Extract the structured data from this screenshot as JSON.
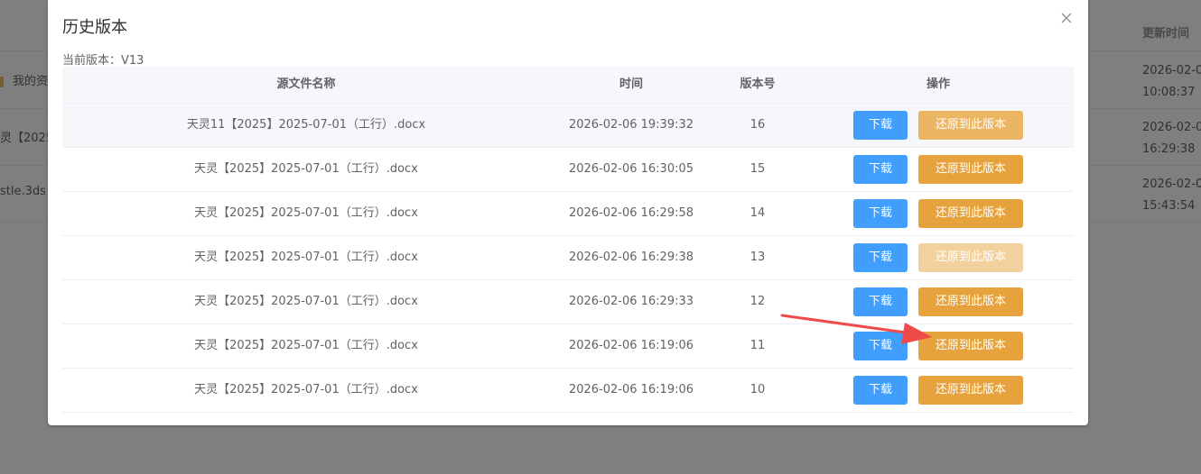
{
  "background": {
    "column_title": "更新时间",
    "rows": [
      {
        "name": "我的资",
        "date": "2026-02-0",
        "time": "10:08:37"
      },
      {
        "name": "灵【2025",
        "date": "2026-02-0",
        "time": "16:29:38"
      },
      {
        "name": "stle.3ds",
        "date": "2026-02-0",
        "time": "15:43:54"
      }
    ]
  },
  "dialog": {
    "title": "历史版本",
    "current_version": "当前版本：V13",
    "columns": {
      "name": "源文件名称",
      "time": "时间",
      "version": "版本号",
      "actions": "操作"
    },
    "download_label": "下载",
    "restore_label": "还原到此版本",
    "rows": [
      {
        "name": "天灵11【2025】2025-07-01（工行）.docx",
        "time": "2026-02-06 19:39:32",
        "version": "16"
      },
      {
        "name": "天灵【2025】2025-07-01（工行）.docx",
        "time": "2026-02-06 16:30:05",
        "version": "15"
      },
      {
        "name": "天灵【2025】2025-07-01（工行）.docx",
        "time": "2026-02-06 16:29:58",
        "version": "14"
      },
      {
        "name": "天灵【2025】2025-07-01（工行）.docx",
        "time": "2026-02-06 16:29:38",
        "version": "13"
      },
      {
        "name": "天灵【2025】2025-07-01（工行）.docx",
        "time": "2026-02-06 16:29:33",
        "version": "12"
      },
      {
        "name": "天灵【2025】2025-07-01（工行）.docx",
        "time": "2026-02-06 16:19:06",
        "version": "11"
      },
      {
        "name": "天灵【2025】2025-07-01（工行）.docx",
        "time": "2026-02-06 16:19:06",
        "version": "10"
      }
    ]
  },
  "colors": {
    "primary": "#409eff",
    "warning": "#e6a23c",
    "warning_disabled": "#f3d19e",
    "annotation_arrow": "#f04a4a"
  },
  "icons": {
    "close": "close-icon"
  }
}
